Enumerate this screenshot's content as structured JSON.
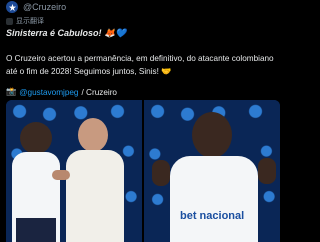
{
  "account": {
    "handle": "@Cruzeiro"
  },
  "translate": {
    "label": "显示翻译"
  },
  "tweet": {
    "line1": "Sinisterra é Cabuloso! 🦊💙",
    "body": "O Cruzeiro acertou a permanência, em definitivo, do atacante colombiano até o fim de 2028! Seguimos juntos, Sinis! 🤝",
    "credit_prefix": "📸",
    "credit_user": "@gustavomjpeg",
    "credit_suffix": "/ Cruzeiro"
  },
  "photos": {
    "right_sponsor": "bet nacional"
  },
  "colors": {
    "accent": "#1d9bf0",
    "brand": "#1d4a96",
    "background": "#000000"
  }
}
